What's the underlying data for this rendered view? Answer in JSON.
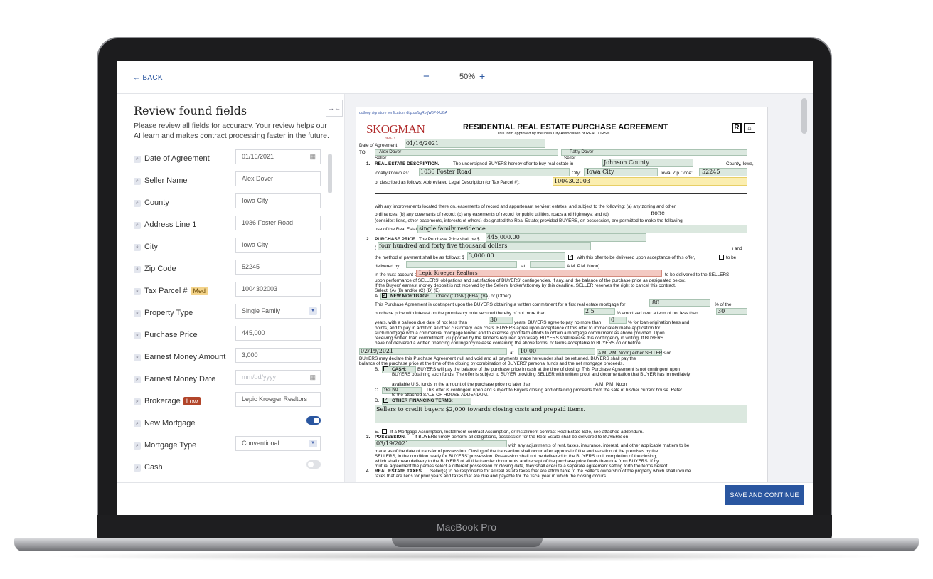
{
  "device": {
    "label": "MacBook Pro"
  },
  "toolbar": {
    "back": "← BACK",
    "zoom_out": "−",
    "zoom_level": "50%",
    "zoom_in": "+"
  },
  "panel": {
    "title": "Review found fields",
    "description": "Please review all fields for accuracy. Your review helps our AI learn and makes contract processing faster in the future.",
    "collapse": "→←"
  },
  "fields": [
    {
      "label": "Date of Agreement",
      "value": "01/16/2021",
      "kind": "date"
    },
    {
      "label": "Seller Name",
      "value": "Alex Dover",
      "kind": "text"
    },
    {
      "label": "County",
      "value": "Iowa City",
      "kind": "text"
    },
    {
      "label": "Address Line 1",
      "value": "1036 Foster Road",
      "kind": "text"
    },
    {
      "label": "City",
      "value": "Iowa City",
      "kind": "text"
    },
    {
      "label": "Zip Code",
      "value": "52245",
      "kind": "text"
    },
    {
      "label": "Tax Parcel #",
      "badge": "Med",
      "value": "1004302003",
      "kind": "text"
    },
    {
      "label": "Property Type",
      "value": "Single Family",
      "kind": "select"
    },
    {
      "label": "Purchase Price",
      "value": "445,000",
      "kind": "text"
    },
    {
      "label": "Earnest Money Amount",
      "value": "3,000",
      "kind": "text"
    },
    {
      "label": "Earnest Money Date",
      "placeholder": "mm/dd/yyyy",
      "kind": "date"
    },
    {
      "label": "Brokerage",
      "badge": "Low",
      "value": "Lepic Kroeger Realtors",
      "kind": "text"
    },
    {
      "label": "New Mortgage",
      "toggle": true,
      "kind": "toggle"
    },
    {
      "label": "Mortgage Type",
      "value": "Conventional",
      "kind": "select"
    },
    {
      "label": "Cash",
      "toggle": false,
      "kind": "toggle"
    }
  ],
  "footer": {
    "save_label": "SAVE AND CONTINUE"
  },
  "document": {
    "verification": "dotloop signature verification: dtlp.us/bgRo-jW6P-XUGA",
    "brand": "SKOGMAN",
    "brand_sub": "REALTY",
    "title": "RESIDENTIAL REAL ESTATE PURCHASE AGREEMENT",
    "subtitle": "This form approved by the Iowa City Association of REALTORS®",
    "date_label": "Date of Agreement",
    "date_value": "01/16/2021",
    "to_label": "TO",
    "seller_1": "Alex Dover",
    "seller_2": "Patty Dover",
    "seller_caption": "Seller",
    "s1_num": "1.",
    "s1_head": "REAL ESTATE DESCRIPTION.",
    "s1_text": "The undersigned BUYERS hereby offer to buy real estate in",
    "county_value": "Johnson County",
    "county_suffix": "County, Iowa,",
    "locally_known": "locally known as:",
    "address_value": "1036 Foster Road",
    "city_label": "City:",
    "city_value": "Iowa City",
    "zip_label": "Iowa, Zip Code:",
    "zip_value": "52245",
    "legal_label": "or described as follows:  Abbreviated Legal Description (or Tax Parcel #):",
    "parcel_value": "1004302003",
    "improvements": "with any improvements located there on, easements of record and appurtenant servient estates, and subject to the following:  (a) any zoning and other",
    "ordinances": "ordinances; (b) any covenants of record; (c) any easements of record for public utilities, roads and highways; and (d)",
    "none_value": "none",
    "consider": "(consider: liens, other easements, interests of others) designated the Real Estate; provided BUYERS, on possession, are permitted to make the following",
    "use_label": "use of the Real Estate:",
    "use_value": "single family residence",
    "s2_num": "2.",
    "s2_head": "PURCHASE PRICE.",
    "s2_text": "The Purchase Price shall be $",
    "price_value": "445,000.00",
    "price_words": "four hundred and forty five thousand dollars",
    "and_label": ") and",
    "method_label": "the method of payment shall be as follows: $",
    "earnest_value": "3,000.00",
    "with_offer": "with this offer to be delivered upon acceptance of this offer,",
    "to_be": "to be",
    "delivered_by": "delivered by",
    "at_label": "at",
    "am_pm": "A.M.  P.M.  Noon)",
    "trust_label": "in the trust account of",
    "brokerage_value": "Lepic Kroeger Realtors",
    "trust_suffix": "to be delivered to the SELLERS",
    "upon_perf": "upon performance of SELLERS' obligations and satisfaction of BUYERS' contingencies, if any, and the balance of the purchase price as designated below.",
    "if_buyers": "If the Buyers' earnest money deposit is not received by the Sellers' broker/attorney by this deadline, SELLER reserves the right to cancel this contract.",
    "select": "Select:  (A) (B) and/or (C) (D) (E)",
    "a_label": "A.",
    "new_mortgage": "NEW MORTGAGE:",
    "check_opts": "Check  (CONV)   (FHA)   (VA) or   (Other)",
    "contingent": "This Purchase Agreement is contingent upon the BUYERS obtaining a written commitment for a first real estate mortgage for",
    "ltv_value": "80",
    "pct_of": "% of the",
    "purchase_price_int": "purchase price with interest on the promissory note secured thereby of not more than",
    "rate_value": "2.5",
    "amortized": "% amortized over a term of not less than",
    "term_value": "30",
    "years_balloon": "years, with a balloon due date of not less than",
    "balloon_value": "30",
    "years_pay": "years.  BUYERS agree to pay no more than",
    "points_value": "0",
    "loan_orig": "% for loan origination fees and",
    "points_line": "points, and to pay in addition all other customary loan costs.  BUYERS agree upon acceptance of this offer to immediately make application for",
    "such_mortgage": "such mortgage with a commercial mortgage lender and to exercise good faith efforts to obtain a mortgage commitment as above provided.  Upon",
    "receiving": "receiving written loan commitment, (supported by the lender's required appraisal), BUYERS shall release this contingency in writing.  If BUYERS",
    "have_not": "have not delivered a written financing contingency release containing the above terms, or terms acceptable to BUYERS on or before",
    "fin_date": "02/19/2021",
    "fin_at": "at",
    "fin_time": "10:00",
    "fin_ampm": "A.M.   P.M.   Noon)  either SELLERS or",
    "buyers_may": "BUYERS may declare this Purchase Agreement null and void and all payments made hereunder shall be returned.  BUYERS shall pay the",
    "balance_of": "balance of the purchase price at the time of the closing by combination of BUYERS' personal funds and the net mortgage proceeds.",
    "b_label": "B.",
    "cash_head": "CASH:",
    "cash_text": "BUYERS will pay the balance of the purchase price in cash at the time of closing.  This Purchase Agreement is not contingent upon",
    "cash_text2": "BUYERS obtaining such funds.  The offer is subject to BUYER providing SELLER with written proof and documentation that BUYER has immediately",
    "available": "available U.S. funds in the amount of the purchase price no later than",
    "avail_ampm": "A.M.   P.M.   Noon",
    "c_label": "C.",
    "c_opts": "Yes   No",
    "c_text": "This offer is contingent upon and subject to Buyers closing and obtaining proceeds from the sale of his/her current house.  Refer",
    "c_text2": "to the attached SALE OF HOUSE ADDENDUM.",
    "d_label": "D.",
    "other_fin": "OTHER FINANCING TERMS:",
    "other_fin_value": "Sellers to credit buyers $2,000 towards closing costs and prepaid items.",
    "e_label": "E.",
    "e_text": "If a Mortgage Assumption, Installment contract Assumption, or Installment contract Real Estate Sale, see attached addendum.",
    "s3_num": "3.",
    "s3_head": "POSSESSION.",
    "s3_text": "If BUYERS timely perform all obligations, possession for the Real Estate shall be delivered to BUYERS on",
    "poss_date": "03/19/2021",
    "poss_adj": "with any adjustments of rent, taxes, insurance, interest, and other applicable matters to be",
    "made_as": "made as of the date of transfer of possession.  Closing of the transaction shall occur after approval of title and vacation of the premises by the",
    "sellers_cond": "SELLERS, in the condition ready for BUYERS' possession.  Possession shall not be delivered to the BUYERS until completion of the closing,",
    "which_shall": "which shall mean delivery to the BUYERS of all title transfer documents and receipt of the purchase price funds then due from BUYERS.  If by",
    "mutual": "mutual agreement the parties select a different possession or closing date, they shall execute a separate agreement setting forth the terms hereof.",
    "s4_num": "4.",
    "s4_head": "REAL ESTATE TAXES.",
    "s4_text": "Seller(s) to be responsible for all real estate taxes that are attributable to the Seller's ownership of the property which shall include",
    "taxes_liens": "taxes that are liens for prior years and taxes that are due and payable for the fiscal year in which the closing occurs."
  }
}
